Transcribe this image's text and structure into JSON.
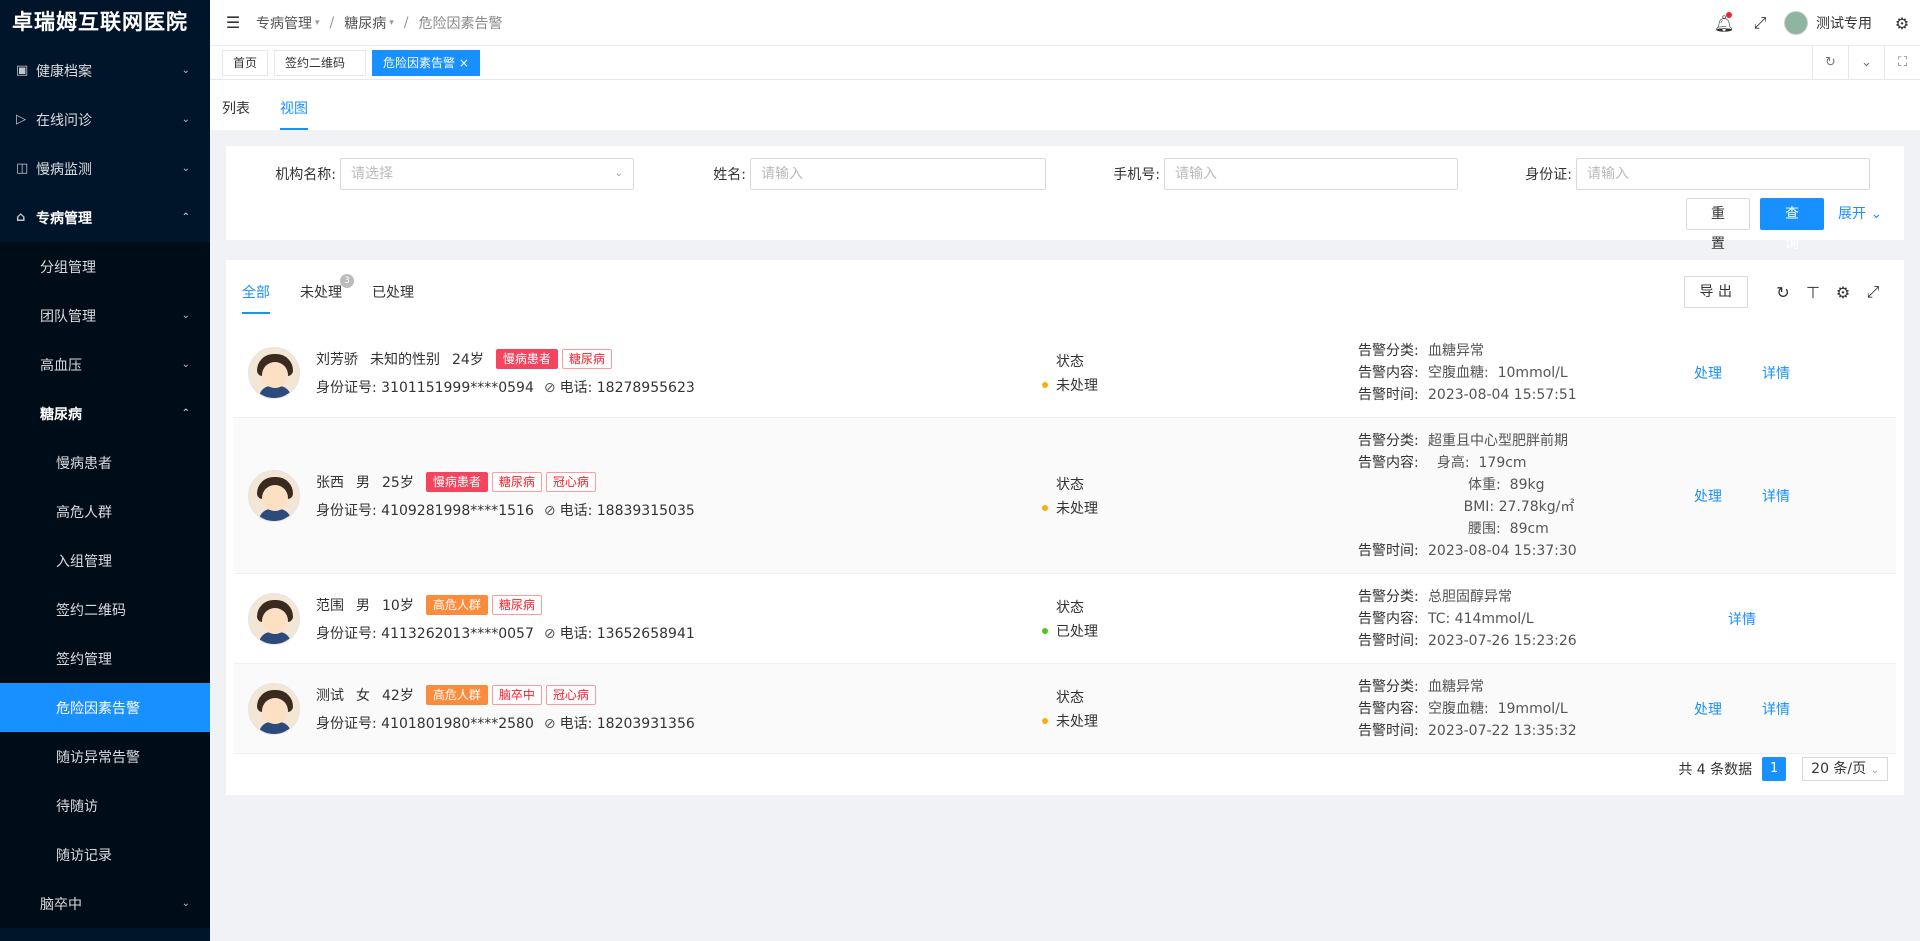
{
  "app": {
    "title": "卓瑞姆互联网医院"
  },
  "sidebar": {
    "items": [
      {
        "label": "健康档案",
        "icon": "id-card-icon",
        "arrow": "⌄"
      },
      {
        "label": "在线问诊",
        "icon": "send-icon",
        "arrow": "⌄"
      },
      {
        "label": "慢病监测",
        "icon": "monitor-icon",
        "arrow": "⌄"
      },
      {
        "label": "专病管理",
        "icon": "bank-icon",
        "arrow": "⌃"
      },
      {
        "label": "分组管理"
      },
      {
        "label": "团队管理",
        "arrow": "⌄"
      },
      {
        "label": "高血压",
        "arrow": "⌄"
      },
      {
        "label": "糖尿病",
        "arrow": "⌃"
      },
      {
        "label": "慢病患者"
      },
      {
        "label": "高危人群"
      },
      {
        "label": "入组管理"
      },
      {
        "label": "签约二维码"
      },
      {
        "label": "签约管理"
      },
      {
        "label": "危险因素告警"
      },
      {
        "label": "随访异常告警"
      },
      {
        "label": "待随访"
      },
      {
        "label": "随访记录"
      },
      {
        "label": "脑卒中",
        "arrow": "⌄"
      }
    ]
  },
  "header": {
    "breadcrumb": [
      "专病管理",
      "糖尿病",
      "危险因素告警"
    ],
    "user": "测试专用"
  },
  "view_tabs": {
    "items": [
      "首页",
      "签约二维码",
      "危险因素告警"
    ],
    "close": "×"
  },
  "subtabs": [
    "列表",
    "视图"
  ],
  "search": {
    "org_label": "机构名称:",
    "org_placeholder": "请选择",
    "name_label": "姓名:",
    "name_placeholder": "请输入",
    "phone_label": "手机号:",
    "phone_placeholder": "请输入",
    "id_label": "身份证:",
    "id_placeholder": "请输入",
    "reset": "重 置",
    "query": "查 询",
    "expand": "展开"
  },
  "list": {
    "tabs": [
      "全部",
      "未处理",
      "已处理"
    ],
    "pending_badge": "3",
    "export": "导 出",
    "status_label": "状态",
    "alert_keys": {
      "category": "告警分类:",
      "content": "告警内容:",
      "time": "告警时间:"
    },
    "action_handle": "处理",
    "action_detail": "详情",
    "rows": [
      {
        "name": "刘芳骄",
        "gender": "未知的性别",
        "age": "24岁",
        "tags": [
          "慢病患者",
          "糖尿病"
        ],
        "id_no": "身份证号: 3101151999****0594",
        "phone": "电话: 18278955623",
        "status": "未处理",
        "status_color": "#faad14",
        "category": "血糖异常",
        "content": [
          "空腹血糖:  10mmol/L"
        ],
        "time": "2023-08-04 15:57:51",
        "handle": true
      },
      {
        "name": "张西",
        "gender": "男",
        "age": "25岁",
        "tags": [
          "慢病患者",
          "糖尿病",
          "冠心病"
        ],
        "id_no": "身份证号: 4109281998****1516",
        "phone": "电话: 18839315035",
        "status": "未处理",
        "status_color": "#faad14",
        "category": "超重且中心型肥胖前期",
        "content": [
          "  身高:  179cm",
          "         体重:  89kg",
          "        BMI: 27.78kg/㎡",
          "         腰围:  89cm"
        ],
        "time": "2023-08-04 15:37:30",
        "handle": true
      },
      {
        "name": "范围",
        "gender": "男",
        "age": "10岁",
        "tags": [
          "高危人群",
          "糖尿病"
        ],
        "id_no": "身份证号: 4113262013****0057",
        "phone": "电话: 13652658941",
        "status": "已处理",
        "status_color": "#52c41a",
        "category": "总胆固醇异常",
        "content": [
          "TC: 414mmol/L"
        ],
        "time": "2023-07-26 15:23:26",
        "handle": false
      },
      {
        "name": "测试",
        "gender": "女",
        "age": "42岁",
        "tags": [
          "高危人群",
          "脑卒中",
          "冠心病"
        ],
        "id_no": "身份证号: 4101801980****2580",
        "phone": "电话: 18203931356",
        "status": "未处理",
        "status_color": "#faad14",
        "category": "血糖异常",
        "content": [
          "空腹血糖:  19mmol/L"
        ],
        "time": "2023-07-22 13:35:32",
        "handle": true
      }
    ]
  },
  "pager": {
    "total": "共 4 条数据",
    "page": "1",
    "size": "20 条/页"
  },
  "colors": {
    "primary": "#1890ff",
    "sidebar_bg": "#001529",
    "tag_red": "#f5445e",
    "tag_orange": "#fa8c3c"
  }
}
